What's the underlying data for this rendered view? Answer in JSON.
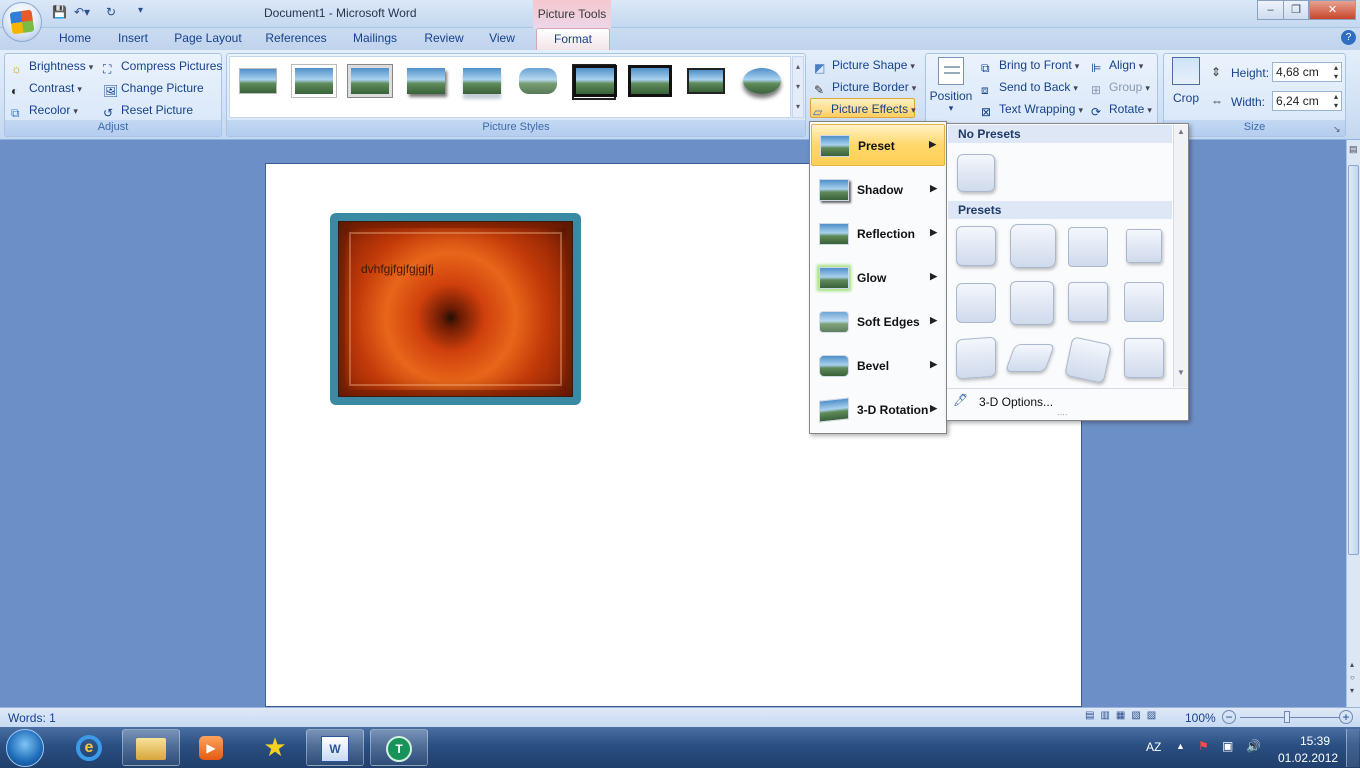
{
  "window": {
    "title": "Document1 - Microsoft Word",
    "context_title": "Picture Tools"
  },
  "tabs": [
    "Home",
    "Insert",
    "Page Layout",
    "References",
    "Mailings",
    "Review",
    "View",
    "Format"
  ],
  "adjust": {
    "label": "Adjust",
    "brightness": "Brightness",
    "contrast": "Contrast",
    "recolor": "Recolor",
    "compress": "Compress Pictures",
    "change": "Change Picture",
    "reset": "Reset Picture"
  },
  "styles": {
    "label": "Picture Styles"
  },
  "shape": {
    "shape": "Picture Shape",
    "border": "Picture Border",
    "effects": "Picture Effects"
  },
  "arrange": {
    "position": "Position",
    "front": "Bring to Front",
    "back": "Send to Back",
    "wrap": "Text Wrapping",
    "align": "Align",
    "group": "Group",
    "rotate": "Rotate"
  },
  "size": {
    "crop": "Crop",
    "height_label": "Height:",
    "height": "4,68 cm",
    "width_label": "Width:",
    "width": "6,24 cm",
    "label": "Size"
  },
  "document": {
    "picture_text": "dvhfgjfgjfgjgjfj"
  },
  "effects_menu": [
    "Preset",
    "Shadow",
    "Reflection",
    "Glow",
    "Soft Edges",
    "Bevel",
    "3-D Rotation"
  ],
  "preset_menu": {
    "no_presets": "No Presets",
    "presets": "Presets",
    "options": "3-D Options..."
  },
  "status": {
    "words": "Words: 1",
    "zoom": "100%"
  },
  "tray": {
    "lang": "AZ",
    "time": "15:39",
    "date": "01.02.2012"
  }
}
